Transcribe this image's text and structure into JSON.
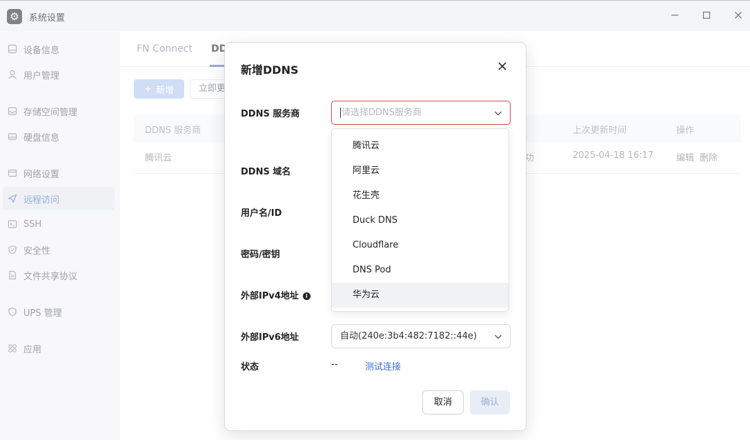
{
  "window": {
    "title": "系统设置",
    "app_icon": "gear-icon",
    "minimize": "—",
    "maximize": "☐",
    "close": "✕"
  },
  "sidebar": {
    "items": [
      {
        "label": "设备信息",
        "icon": "device-icon"
      },
      {
        "label": "用户管理",
        "icon": "user-icon"
      },
      {
        "label": "存储空间管理",
        "icon": "storage-icon"
      },
      {
        "label": "硬盘信息",
        "icon": "disk-icon"
      },
      {
        "label": "网络设置",
        "icon": "network-icon"
      },
      {
        "label": "远程访问",
        "icon": "send-icon",
        "active": true
      },
      {
        "label": "SSH",
        "icon": "terminal-icon"
      },
      {
        "label": "安全性",
        "icon": "shield-icon"
      },
      {
        "label": "文件共享协议",
        "icon": "file-icon"
      },
      {
        "label": "UPS 管理",
        "icon": "ups-shield-icon"
      },
      {
        "label": "应用",
        "icon": "apps-icon"
      }
    ]
  },
  "main": {
    "tabs": [
      {
        "label": "FN Connect"
      },
      {
        "label": "DDNS",
        "active": true
      }
    ],
    "add_button": "新增",
    "update_button": "立即更新",
    "table": {
      "headers": [
        "DDNS 服务商",
        "上次更新时间",
        "操作"
      ],
      "rows": [
        {
          "provider": "腾讯云",
          "status": "成功",
          "updated": "2025-04-18 16:17",
          "edit": "编辑",
          "delete": "删除"
        }
      ]
    }
  },
  "dialog": {
    "title": "新增DDNS",
    "labels": {
      "provider": "DDNS 服务商",
      "domain": "DDNS 域名",
      "username": "用户名/ID",
      "password": "密码/密钥",
      "ipv4": "外部IPv4地址",
      "ipv6": "外部IPv6地址",
      "status": "状态"
    },
    "provider_placeholder": "请选择DDNS服务商",
    "ipv6_value": "自动(240e:3b4:482:7182::44e)",
    "status_value": "--",
    "test_link": "测试连接",
    "cancel": "取消",
    "confirm": "确认"
  },
  "dropdown": {
    "options": [
      "腾讯云",
      "阿里云",
      "花生壳",
      "Duck DNS",
      "Cloudflare",
      "DNS Pod",
      "华为云"
    ],
    "hovered": "华为云"
  }
}
